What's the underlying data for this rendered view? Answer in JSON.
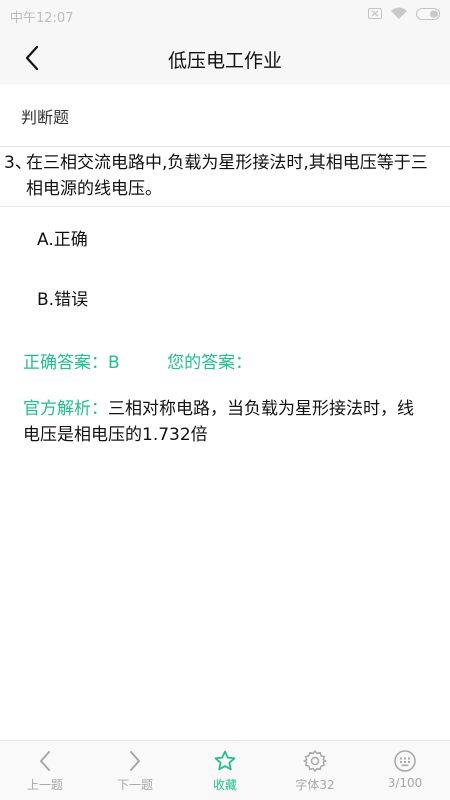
{
  "status_bar": {
    "time": "中午12:07"
  },
  "header": {
    "title": "低压电工作业",
    "back_icon": "chevron-left-icon"
  },
  "question": {
    "type": "判断题",
    "number": "3、",
    "text": "在三相交流电路中,负载为星形接法时,其相电压等于三相电源的线电压。",
    "options": [
      {
        "label": "A.正确"
      },
      {
        "label": "B.错误"
      }
    ]
  },
  "answers": {
    "correct": "正确答案：B",
    "yours": "您的答案："
  },
  "analysis": {
    "label": "官方解析：",
    "text": "三相对称电路，当负载为星形接法时，线电压是相电压的1.732倍"
  },
  "tabbar": {
    "items": [
      {
        "label": "上一题",
        "icon": "chevron-left-icon"
      },
      {
        "label": "下一题",
        "icon": "chevron-right-icon"
      },
      {
        "label": "收藏",
        "icon": "star-icon"
      },
      {
        "label": "字体32",
        "icon": "gear-icon"
      },
      {
        "label": "3/100",
        "icon": "keyboard-icon"
      }
    ]
  },
  "colors": {
    "accent": "#20c08e",
    "bar_bg": "#f7f7f7",
    "inactive": "#a8a8a8"
  }
}
